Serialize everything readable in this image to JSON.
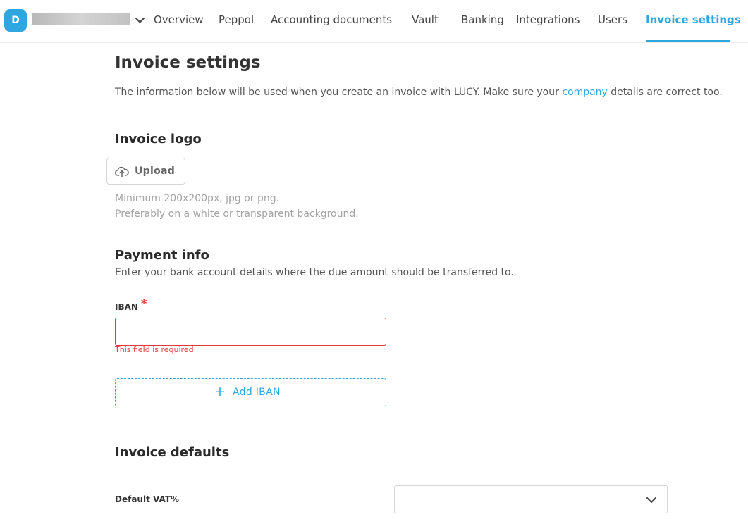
{
  "nav": {
    "avatar_letter": "D",
    "items": [
      {
        "label": "Overview"
      },
      {
        "label": "Peppol"
      },
      {
        "label": "Accounting documents"
      },
      {
        "label": "Vault"
      },
      {
        "label": "Banking"
      },
      {
        "label": "Integrations"
      },
      {
        "label": "Users"
      },
      {
        "label": "Invoice settings",
        "active": true
      }
    ]
  },
  "page": {
    "title": "Invoice settings",
    "intro_before": "The information below will be used when you create an invoice with LUCY. Make sure your ",
    "intro_link": "company",
    "intro_after": " details are correct too."
  },
  "logo_section": {
    "title": "Invoice logo",
    "upload_label": "Upload",
    "hint_line1": "Minimum 200x200px, jpg or png.",
    "hint_line2": "Preferably on a white or transparent background."
  },
  "payment_section": {
    "title": "Payment info",
    "description": "Enter your bank account details where the due amount should be transferred to.",
    "iban_label": "IBAN",
    "required_mark": "*",
    "iban_value": "",
    "iban_error": "This field is required",
    "add_iban_label": "Add IBAN",
    "add_iban_plus": "+"
  },
  "defaults_section": {
    "title": "Invoice defaults",
    "vat_label": "Default VAT%",
    "vat_value": ""
  },
  "colors": {
    "accent": "#2ea7e0",
    "error": "#e53935",
    "text": "#333333",
    "muted": "#a3a3a3"
  }
}
